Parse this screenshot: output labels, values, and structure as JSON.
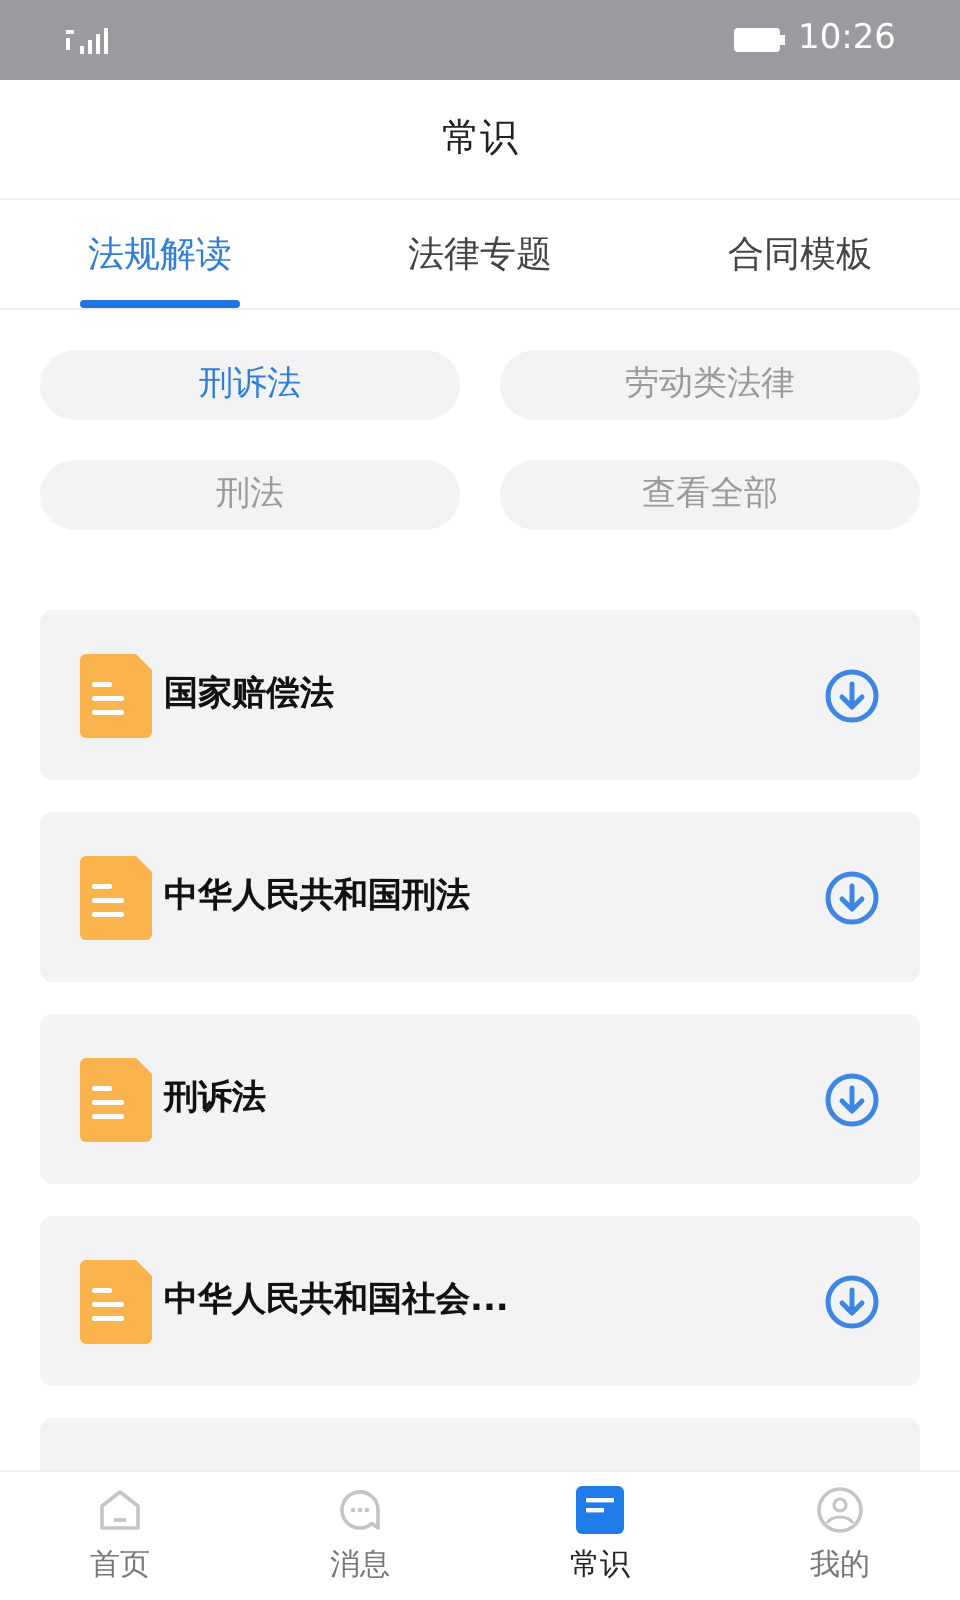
{
  "status_bar": {
    "time": "10:26"
  },
  "header": {
    "title": "常识"
  },
  "tabs": [
    {
      "label": "法规解读",
      "selected": true
    },
    {
      "label": "法律专题",
      "selected": false
    },
    {
      "label": "合同模板",
      "selected": false
    }
  ],
  "filters": [
    {
      "label": "刑诉法",
      "selected": true
    },
    {
      "label": "劳动类法律",
      "selected": false
    },
    {
      "label": "刑法",
      "selected": false
    },
    {
      "label": "查看全部",
      "selected": false
    }
  ],
  "documents": [
    {
      "title": "国家赔偿法"
    },
    {
      "title": "中华人民共和国刑法"
    },
    {
      "title": "刑诉法"
    },
    {
      "title": "中华人民共和国社会..."
    }
  ],
  "bottom_nav": [
    {
      "label": "首页",
      "kind": "home",
      "selected": false
    },
    {
      "label": "消息",
      "kind": "message",
      "selected": false
    },
    {
      "label": "常识",
      "kind": "knowledge",
      "selected": true
    },
    {
      "label": "我的",
      "kind": "profile",
      "selected": false
    }
  ]
}
